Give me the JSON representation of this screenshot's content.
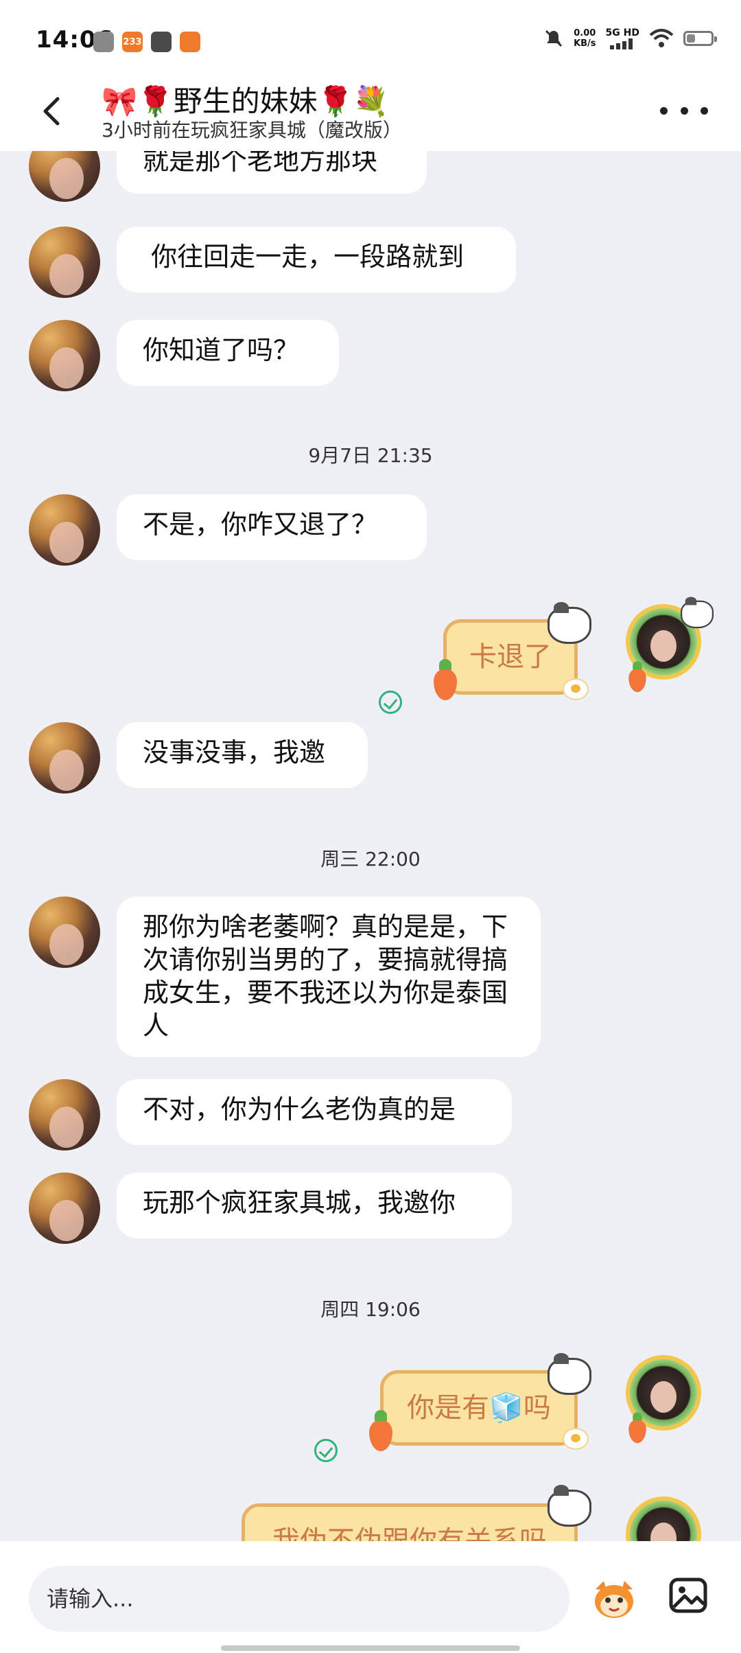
{
  "status_bar": {
    "time": "14:06",
    "app_icons": [
      {
        "name": "app-a-icon",
        "label": "",
        "color": "#888888"
      },
      {
        "name": "app-233-icon",
        "label": "233",
        "color": "#f07a2c"
      },
      {
        "name": "app-bag-icon",
        "label": "",
        "color": "#4a4a4a"
      },
      {
        "name": "app-meme-icon",
        "label": "",
        "color": "#f07a2c"
      }
    ],
    "net_speed_value": "0.00",
    "net_speed_unit": "KB/s",
    "network_type": "5G HD",
    "icons": [
      "mute-icon",
      "signal-icon",
      "wifi-icon",
      "battery-icon"
    ],
    "battery_level": 0.35
  },
  "header": {
    "back_icon": "chevron-left-icon",
    "title": "🎀🌹野生的妹妹🌹💐",
    "subtitle": "3小时前在玩疯狂家具城（魔改版）",
    "more_icon": "more-dots-icon"
  },
  "messages": [
    {
      "side": "left",
      "text": "就是那个老地方那块"
    },
    {
      "side": "left",
      "text": " 你往回走一走，一段路就到"
    },
    {
      "side": "left",
      "text": "你知道了吗？"
    },
    {
      "type": "timestamp",
      "text": "9月7日 21:35"
    },
    {
      "side": "left",
      "text": "不是，你咋又退了？"
    },
    {
      "side": "right",
      "text": "卡退了",
      "read": true
    },
    {
      "side": "left",
      "text": "没事没事，我邀"
    },
    {
      "type": "timestamp",
      "text": "周三 22:00"
    },
    {
      "side": "left",
      "text": "那你为啥老萎啊？真的是是，下次请你别当男的了，要搞就得搞成女生，要不我还以为你是泰国人"
    },
    {
      "side": "left",
      "text": "不对，你为什么老伪真的是"
    },
    {
      "side": "left",
      "text": "玩那个疯狂家具城，我邀你"
    },
    {
      "type": "timestamp",
      "text": "周四 19:06"
    },
    {
      "side": "right",
      "text": "你是有🧊吗",
      "read": true
    },
    {
      "side": "right",
      "text": "我伪不伪跟你有关系吗"
    }
  ],
  "input": {
    "placeholder": "请输入...",
    "emoji_icon": "emoji-face-icon",
    "image_icon": "image-picker-icon"
  },
  "colors": {
    "background": "#eef0f5",
    "bubble_left": "#ffffff",
    "bubble_right": "#fbe3a3",
    "bubble_right_border": "#e6b266",
    "bubble_right_text": "#c97a45",
    "read_check": "#2fb37a"
  }
}
